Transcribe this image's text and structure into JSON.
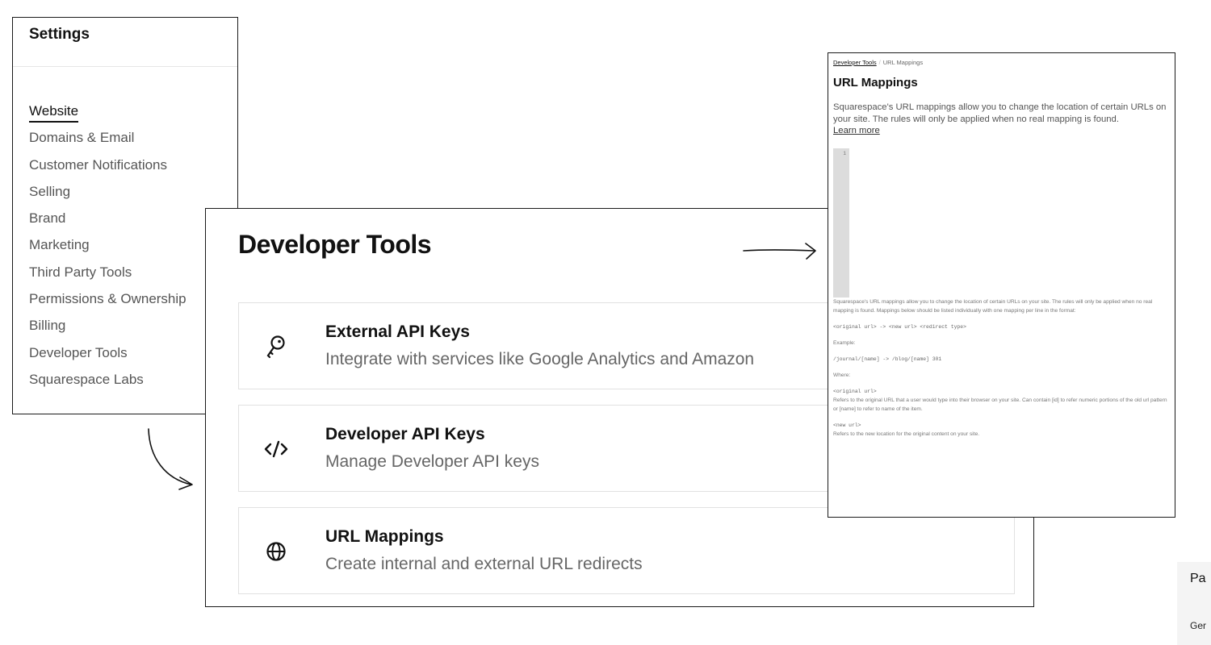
{
  "settings": {
    "title": "Settings",
    "items": [
      {
        "label": "Website",
        "active": true
      },
      {
        "label": "Domains & Email"
      },
      {
        "label": "Customer Notifications"
      },
      {
        "label": "Selling"
      },
      {
        "label": "Brand"
      },
      {
        "label": "Marketing"
      },
      {
        "label": "Third Party Tools"
      },
      {
        "label": "Permissions & Ownership"
      },
      {
        "label": "Billing"
      },
      {
        "label": "Developer Tools"
      },
      {
        "label": "Squarespace Labs"
      }
    ]
  },
  "developer_tools": {
    "title": "Developer Tools",
    "cards": [
      {
        "icon": "key-icon",
        "title": "External API Keys",
        "description": "Integrate with services like Google Analytics and Amazon"
      },
      {
        "icon": "code-icon",
        "title": "Developer API Keys",
        "description": "Manage Developer API keys"
      },
      {
        "icon": "globe-icon",
        "title": "URL Mappings",
        "description": "Create internal and external URL redirects"
      }
    ]
  },
  "url_mappings": {
    "breadcrumb": {
      "parent": "Developer Tools",
      "current": "URL Mappings"
    },
    "title": "URL Mappings",
    "description": "Squarespace's URL mappings allow you to change the location of certain URLs on your site. The rules will only be applied when no real mapping is found.",
    "learn_more": "Learn more",
    "editor_line_number": "1",
    "help": {
      "intro": "Squarespace's URL mappings allow you to change the location of certain URLs on your site. The rules will only be applied when no real mapping is found. Mappings below should be listed individually with one mapping per line in the format:",
      "format": "<original url> -> <new url> <redirect type>",
      "example_label": "Example:",
      "example": "/journal/[name] -> /blog/[name] 301",
      "where_label": "Where:",
      "original_term": "<original url>",
      "original_def": "Refers to the original URL that a user would type into their browser on your site. Can contain [id] to refer numeric portions of the old url pattern or [name] to refer to name of the item.",
      "new_term": "<new url>",
      "new_def": "Refers to the new location for the original content on your site."
    }
  },
  "cropped_page": {
    "title": "Pa",
    "item": "Ger"
  }
}
